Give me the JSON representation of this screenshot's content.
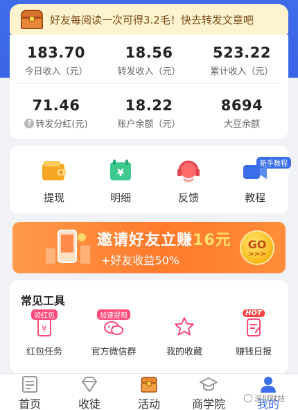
{
  "notice": {
    "text": "好友每阅读一次可得3.2毛！快去转发文章吧"
  },
  "stats": {
    "row1": [
      {
        "value": "183.70",
        "label": "今日收入（元）"
      },
      {
        "value": "18.56",
        "label": "转发收入（元）"
      },
      {
        "value": "523.22",
        "label": "累计收入（元）"
      }
    ],
    "row2": [
      {
        "value": "71.46",
        "label": "转发分红(元)",
        "help_icon": "question-icon"
      },
      {
        "value": "18.22",
        "label": "账户余额（元）"
      },
      {
        "value": "8694",
        "label": "大豆余额"
      }
    ]
  },
  "menu": {
    "items": [
      {
        "label": "提现",
        "icon": "wallet-icon"
      },
      {
        "label": "明细",
        "icon": "ledger-icon"
      },
      {
        "label": "反馈",
        "icon": "headset-icon"
      },
      {
        "label": "教程",
        "icon": "video-icon",
        "tag": "新手教程"
      }
    ]
  },
  "banner": {
    "title_prefix": "邀请好友立赚",
    "title_highlight": "16元",
    "subtitle": "+好友收益50%",
    "button": "GO",
    "button_arrows": ">>>"
  },
  "tools": {
    "title": "常见工具",
    "items": [
      {
        "label": "红包任务",
        "tag": "领红包",
        "icon": "red-envelope-icon"
      },
      {
        "label": "官方微信群",
        "tag": "加速提现",
        "icon": "wechat-icon"
      },
      {
        "label": "我的收藏",
        "icon": "star-icon"
      },
      {
        "label": "赚钱日报",
        "tag": "HOT",
        "icon": "report-icon"
      }
    ]
  },
  "nav": {
    "items": [
      {
        "label": "首页",
        "icon": "news-icon"
      },
      {
        "label": "收徒",
        "icon": "diamond-icon"
      },
      {
        "label": "活动",
        "icon": "chest-icon"
      },
      {
        "label": "商学院",
        "icon": "graduation-cap-icon"
      },
      {
        "label": "我的",
        "icon": "user-icon",
        "active": true
      }
    ]
  },
  "watermark": {
    "text": "深圳财站"
  },
  "colors": {
    "primary": "#3b6ee9",
    "banner_orange": "#ff7a2c",
    "notice_bg": "#fdf3cf",
    "tag_pink": "#ff4a78"
  }
}
